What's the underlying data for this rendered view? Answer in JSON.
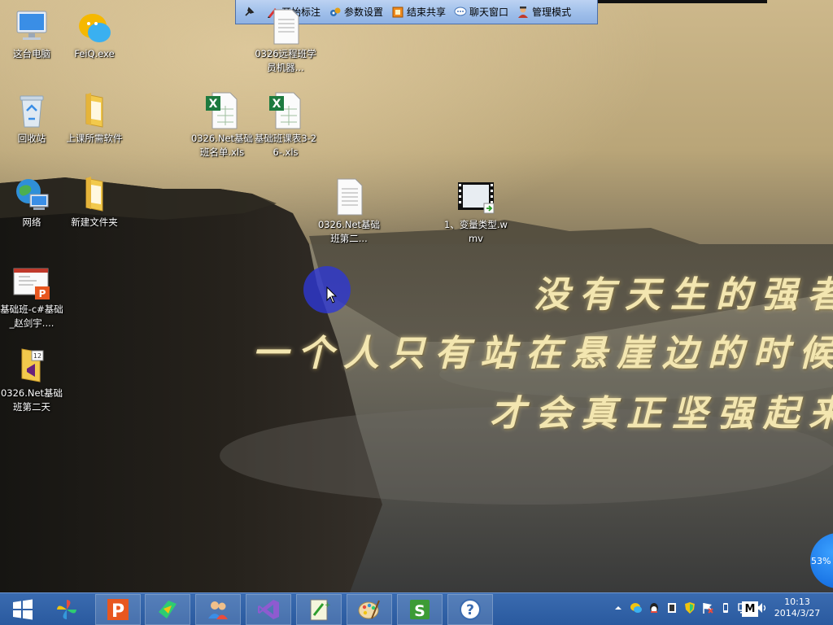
{
  "toolbar": {
    "items": [
      {
        "icon": "pin-icon",
        "label": ""
      },
      {
        "icon": "pen-icon",
        "label": "开始标注"
      },
      {
        "icon": "gear-icon",
        "label": "参数设置"
      },
      {
        "icon": "share-stop-icon",
        "label": "结束共享"
      },
      {
        "icon": "chat-icon",
        "label": "聊天窗口"
      },
      {
        "icon": "admin-icon",
        "label": "管理模式"
      }
    ]
  },
  "desktop": {
    "icons": [
      {
        "name": "this-pc",
        "label": "这台电脑",
        "icon": "computer-icon"
      },
      {
        "name": "feiq",
        "label": "FeiQ.exe",
        "icon": "feiq-icon"
      },
      {
        "name": "remote-class",
        "label": "0326远程班学员机器...",
        "icon": "text-document-icon"
      },
      {
        "name": "recycle-bin",
        "label": "回收站",
        "icon": "recycle-bin-icon"
      },
      {
        "name": "class-software",
        "label": "上课所需软件",
        "icon": "folder-icon"
      },
      {
        "name": "roster-xls",
        "label": "0326.Net基础班名单.xls",
        "icon": "excel-icon"
      },
      {
        "name": "schedule-xls",
        "label": "基础班课表3-26-.xls",
        "icon": "excel-icon"
      },
      {
        "name": "network",
        "label": "网络",
        "icon": "network-icon"
      },
      {
        "name": "new-folder",
        "label": "新建文件夹",
        "icon": "folder-icon"
      },
      {
        "name": "day2-doc",
        "label": "0326.Net基础班第二...",
        "icon": "text-document-icon"
      },
      {
        "name": "variable-video",
        "label": "1、变量类型.wmv",
        "icon": "video-file-icon"
      },
      {
        "name": "csharp-ppt",
        "label": "基础班-c#基础_赵剑宇....",
        "icon": "presentation-icon"
      },
      {
        "name": "day2-vs",
        "label": "0326.Net基础班第二天",
        "icon": "visual-studio-folder-icon"
      }
    ]
  },
  "wallpaper": {
    "poem_lines": [
      "没有天生的强者",
      "一个人只有站在悬崖边的时候",
      "才会真正坚强起来"
    ]
  },
  "progress_bubble": {
    "value": "53%"
  },
  "taskbar": {
    "apps": [
      {
        "name": "start",
        "icon": "windows-start-icon"
      },
      {
        "name": "pinwheel",
        "icon": "pinwheel-icon"
      },
      {
        "name": "powerpoint",
        "icon": "powerpoint-icon"
      },
      {
        "name": "green-app",
        "icon": "green-app-icon"
      },
      {
        "name": "users",
        "icon": "users-icon"
      },
      {
        "name": "visual-studio",
        "icon": "visual-studio-icon"
      },
      {
        "name": "notepad-plus",
        "icon": "notepad-plus-icon"
      },
      {
        "name": "paint",
        "icon": "paint-palette-icon"
      },
      {
        "name": "sublime",
        "icon": "sublime-s-icon"
      },
      {
        "name": "help",
        "icon": "help-icon"
      }
    ],
    "tray": [
      "show-hidden-icon",
      "chat-bubble-icon",
      "qq-icon",
      "film-icon",
      "shield-icon",
      "flag-icon",
      "phone-icon",
      "network-status-icon",
      "volume-icon"
    ],
    "ime": "M",
    "time": "10:13",
    "date": "2014/3/27"
  },
  "colors": {
    "toolbar_bg": "#9fbfea",
    "taskbar_bg": "#2a5a9f",
    "cursor_highlight": "#2d37d7",
    "poem": "#f3e6b0"
  }
}
